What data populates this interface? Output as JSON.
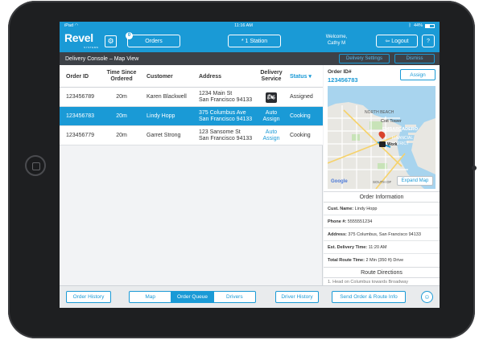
{
  "status_bar": {
    "device": "iPad",
    "wifi": "wifi-icon",
    "time": "11:16 AM",
    "battery": "44%"
  },
  "header": {
    "logo": "Revel",
    "logo_sub": "SYSTEMS",
    "orders_badge": "0",
    "orders_label": "Orders",
    "station_label": "* 1 Station",
    "welcome_line1": "Welcome,",
    "welcome_line2": "Cathy M",
    "logout_label": "Logout",
    "help_label": "?"
  },
  "titlebar": {
    "title": "Delivery Console – Map View",
    "delivery_settings": "Delivery Settings",
    "dismiss": "Dismiss"
  },
  "table": {
    "columns": {
      "order_id": "Order ID",
      "time_line1": "Time Since",
      "time_line2": "Ordered",
      "customer": "Customer",
      "address": "Address",
      "service_line1": "Delivery",
      "service_line2": "Service",
      "status": "Status ▾"
    },
    "rows": [
      {
        "order_id": "123456789",
        "time": "20m",
        "customer": "Karen Blackwell",
        "address_line1": "1234 Main St",
        "address_line2": "San Francisco 94133",
        "service_line1": "",
        "service_line2": "",
        "status": "Assigned"
      },
      {
        "order_id": "123456783",
        "time": "20m",
        "customer": "Lindy Hopp",
        "address_line1": "375 Columbus Ave",
        "address_line2": "San Francisco 94133",
        "service_line1": "Auto",
        "service_line2": "Assign",
        "status": "Cooking"
      },
      {
        "order_id": "123456779",
        "time": "20m",
        "customer": "Garret Strong",
        "address_line1": "123 Sansome St",
        "address_line2": "San Francisco 94133",
        "service_line1": "Auto",
        "service_line2": "Assign",
        "status": "Cooking"
      }
    ]
  },
  "detail": {
    "order_label": "Order ID#",
    "order_id": "123456783",
    "assign": "Assign",
    "map": {
      "north_beach": "NORTH BEACH",
      "coit_tower": "Coit Tower",
      "embarcadero": "EMBARCADERO",
      "financial": "FINANCIAL",
      "district": "DISTRICT",
      "work": "Work",
      "google": "Google",
      "south": "SOUTH OF",
      "expand": "Expand Map"
    },
    "order_info_title": "Order Information",
    "cust_name_label": "Cust. Name:",
    "cust_name": "Lindy Hopp",
    "phone_label": "Phone #:",
    "phone": "5555551234",
    "address_label": "Address:",
    "address": "375 Columbus, San Francisco 94133",
    "est_label": "Est. Delivery Time:",
    "est": "11:20 AM",
    "route_label": "Total Route Time:",
    "route": "2 Min (350 ft) Drive",
    "route_directions_title": "Route Directions",
    "partial_text": "1. Head on Columbus towards Broadway"
  },
  "bottom": {
    "order_history": "Order History",
    "tabs": [
      "Map",
      "Order Queue",
      "Drivers"
    ],
    "driver_history": "Driver History",
    "send_route": "Send Order & Route Info"
  },
  "colors": {
    "accent": "#1a9ad6",
    "titlebar": "#3d4147"
  }
}
